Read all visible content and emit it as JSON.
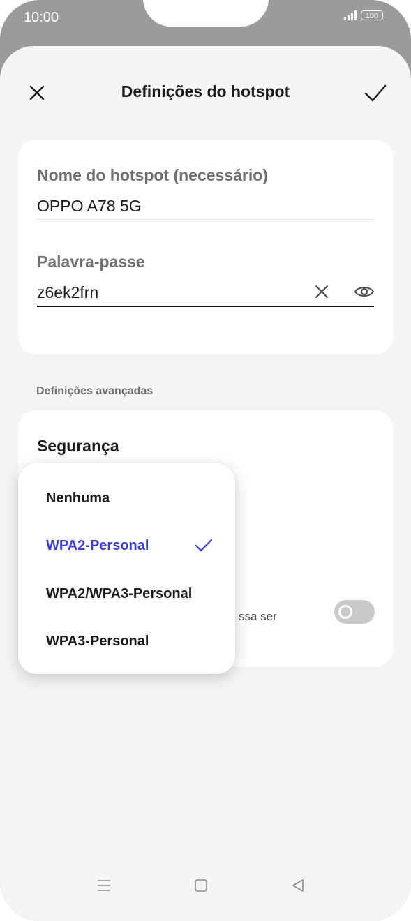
{
  "status_bar": {
    "time": "10:00",
    "battery": "100"
  },
  "header": {
    "title": "Definições do hotspot",
    "close_icon": "close-icon",
    "confirm_icon": "check-icon"
  },
  "hotspot_card": {
    "name_label": "Nome do hotspot (necessário)",
    "name_value": "OPPO A78 5G",
    "password_label": "Palavra-passe",
    "password_value": "z6ek2frn"
  },
  "advanced": {
    "section_title": "Definições avançadas",
    "security_label": "Segurança",
    "partial_text": "ssa ser",
    "toggle_on": false
  },
  "security_menu": {
    "options": [
      {
        "label": "Nenhuma",
        "selected": false
      },
      {
        "label": "WPA2-Personal",
        "selected": true
      },
      {
        "label": "WPA2/WPA3-Personal",
        "selected": false
      },
      {
        "label": "WPA3-Personal",
        "selected": false
      }
    ]
  },
  "nav_bar": {
    "icons": [
      "menu-icon",
      "home-icon",
      "back-icon"
    ]
  },
  "colors": {
    "accent": "#3b3fcf",
    "frame": "#9b9b9b",
    "background": "#f5f5f5"
  }
}
